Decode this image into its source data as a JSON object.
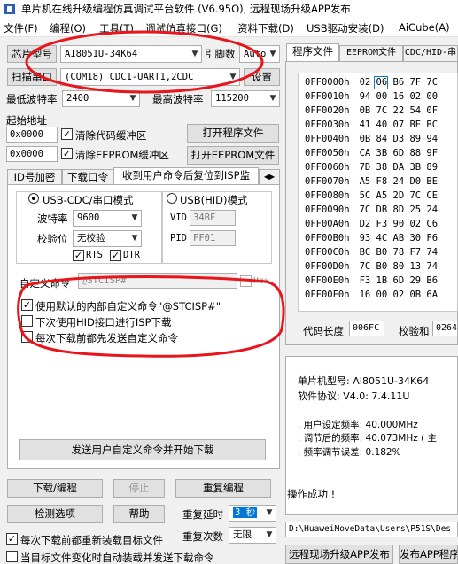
{
  "window": {
    "title": "单片机在线升级编程仿真调试平台软件 (V6.95O), 远程现场升级APP发布"
  },
  "menu": [
    "文件(F)",
    "编程(O)",
    "工具(T)",
    "调试仿真接口(G)",
    "资料下载(D)",
    "USB驱动安装(D)",
    "AiCube(A)"
  ],
  "left": {
    "chip_label": "芯片型号",
    "chip_value": "AI8051U-34K64",
    "pin_label": "引脚数",
    "pin_value": "Auto",
    "scan_button": "扫描串口",
    "port_value": "(COM18) CDC1-UART1,2CDC",
    "settings_button": "设置",
    "min_baud_label": "最低波特率",
    "min_baud_value": "2400",
    "max_baud_label": "最高波特率",
    "max_baud_value": "115200",
    "start_addr_label": "起始地址",
    "addr1": "0x0000",
    "clear_code_label": "清除代码缓冲区",
    "open_prog_button": "打开程序文件",
    "addr2": "0x0000",
    "clear_eeprom_label": "清除EEPROM缓冲区",
    "open_eeprom_button": "打开EEPROM文件",
    "tabs": [
      "ID号加密",
      "下载口令",
      "收到用户命令后复位到ISP监"
    ],
    "usb_cdc_label": "USB-CDC/串口模式",
    "usb_hid_label": "USB(HID)模式",
    "baud_label": "波特率",
    "baud_value": "9600",
    "parity_label": "校验位",
    "parity_value": "无校验",
    "rts_label": "RTS",
    "dtr_label": "DTR",
    "vid_label": "VID",
    "vid_value": "34BF",
    "pid_label": "PID",
    "pid_value": "FF01",
    "custom_cmd_label": "自定义命令",
    "custom_cmd_value": "@STCISP#",
    "hex_label": "Hex",
    "opt1": "使用默认的内部自定义命令\"@STCISP#\"",
    "opt2": "下次使用HID接口进行ISP下载",
    "opt3": "每次下载前都先发送自定义命令",
    "send_button": "发送用户自定义命令并开始下载",
    "download_button": "下载/编程",
    "stop_button": "停止",
    "reprogram_button": "重复编程",
    "detect_button": "检测选项",
    "help_button": "帮助",
    "delay_label": "重复延时",
    "delay_value": "3 秒",
    "count_label": "重复次数",
    "count_value": "无限",
    "reload_label": "每次下载前都重新装载目标文件",
    "auto_load_label": "当目标文件变化时自动装载并发送下载命令"
  },
  "right": {
    "tabs": [
      "程序文件",
      "EEPROM文件",
      "CDC/HID-串"
    ],
    "hex_rows": [
      {
        "addr": "0FF0000h",
        "bytes": "02 06 B6 7F 7C"
      },
      {
        "addr": "0FF0010h",
        "bytes": "94 00 16 02 00"
      },
      {
        "addr": "0FF0020h",
        "bytes": "0B 7C 22 54 0F"
      },
      {
        "addr": "0FF0030h",
        "bytes": "41 40 07 BE BC"
      },
      {
        "addr": "0FF0040h",
        "bytes": "0B 84 D3 89 94"
      },
      {
        "addr": "0FF0050h",
        "bytes": "CA 3B 6D 88 9F"
      },
      {
        "addr": "0FF0060h",
        "bytes": "7D 38 DA 3B 89"
      },
      {
        "addr": "0FF0070h",
        "bytes": "A5 F8 24 D0 BE"
      },
      {
        "addr": "0FF0080h",
        "bytes": "5C A5 2D 7C CE"
      },
      {
        "addr": "0FF0090h",
        "bytes": "7C DB 8D 25 24"
      },
      {
        "addr": "0FF00A0h",
        "bytes": "D2 F3 90 02 C6"
      },
      {
        "addr": "0FF00B0h",
        "bytes": "93 4C AB 30 F6"
      },
      {
        "addr": "0FF00C0h",
        "bytes": "BC B0 78 F7 74"
      },
      {
        "addr": "0FF00D0h",
        "bytes": "7C B0 80 13 74"
      },
      {
        "addr": "0FF00E0h",
        "bytes": "F3 1B 6D 29 B6"
      },
      {
        "addr": "0FF00F0h",
        "bytes": "16 00 02 0B 6A"
      }
    ],
    "code_len_label": "代码长度",
    "code_len_value": "006FC",
    "checksum_label": "校验和",
    "checksum_value": "0264",
    "info_lines": [
      "单片机型号: AI8051U-34K64",
      "软件协议: V4.0: 7.4.11U",
      "",
      ". 用户设定频率: 40.000MHz",
      ". 调节后的频率: 40.073MHz ( 主",
      ". 频率调节误差: 0.182%"
    ],
    "success_text": "操作成功 !",
    "path_value": "D:\\HuaweiMoveData\\Users\\P51S\\Des",
    "remote_button": "远程现场升级APP发布",
    "publish_button": "发布APP程序"
  },
  "colors": {
    "annotation": "#e8151b",
    "selection": "#0078d7"
  }
}
